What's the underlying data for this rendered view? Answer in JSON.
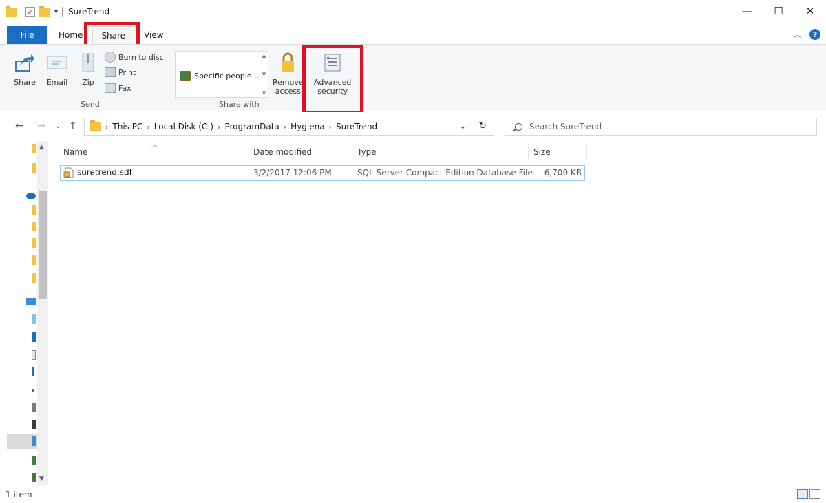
{
  "window": {
    "title": "SureTrend",
    "controls": {
      "minimize": "—",
      "maximize": "☐",
      "close": "✕"
    }
  },
  "ribbon_tabs": [
    {
      "label": "File"
    },
    {
      "label": "Home"
    },
    {
      "label": "Share",
      "active": true
    },
    {
      "label": "View"
    }
  ],
  "ribbon": {
    "send_group": {
      "label": "Send",
      "share": "Share",
      "email": "Email",
      "zip": "Zip",
      "burn": "Burn to disc",
      "print": "Print",
      "fax": "Fax"
    },
    "share_with_group": {
      "label": "Share with",
      "gallery_item": "Specific people...",
      "remove_access_line1": "Remove",
      "remove_access_line2": "access",
      "advanced_line1": "Advanced",
      "advanced_line2": "security"
    }
  },
  "address_bar": {
    "segments": [
      "This PC",
      "Local Disk (C:)",
      "ProgramData",
      "Hygiena",
      "SureTrend"
    ],
    "search_placeholder": "Search SureTrend"
  },
  "columns": {
    "name": "Name",
    "date": "Date modified",
    "type": "Type",
    "size": "Size"
  },
  "files": [
    {
      "name": "suretrend.sdf",
      "date": "3/2/2017 12:06 PM",
      "type": "SQL Server Compact Edition Database File",
      "size": "6,700 KB"
    }
  ],
  "status": {
    "count": "1 item"
  },
  "colors": {
    "accent": "#1a6fc4",
    "highlight": "#e0141e",
    "folder": "#f5c342"
  }
}
